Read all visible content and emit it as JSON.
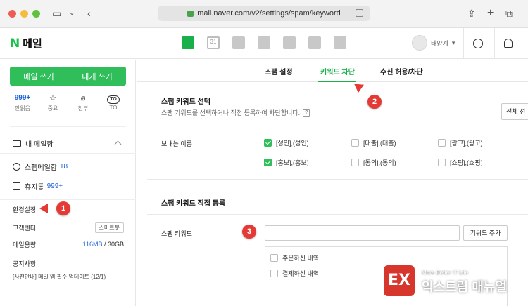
{
  "browser": {
    "url": "mail.naver.com/v2/settings/spam/keyword"
  },
  "header": {
    "logo_letter": "N",
    "logo_text": "메일",
    "calendar_day": "31",
    "profile_name": "태양계"
  },
  "sidebar": {
    "write_button": "메일 쓰기",
    "self_write_button": "내게 쓰기",
    "quick": [
      {
        "value": "999+",
        "label": "안읽음"
      },
      {
        "icon": "star-icon",
        "label": "중요"
      },
      {
        "icon": "paperclip-icon",
        "label": "첨부"
      },
      {
        "badge": "TO",
        "label": "TO"
      }
    ],
    "my_mailbox": "내 메일함",
    "spam_box": "스팸메일함",
    "spam_count": "18",
    "trash": "휴지통",
    "trash_count": "999+",
    "settings": "환경설정",
    "support": "고객센터",
    "smart_bot": "스마트봇",
    "storage_label": "메일용량",
    "storage_used": "116MB",
    "storage_total": "/ 30GB",
    "notice_label": "공지사항",
    "notice_text": "[사전안내] 메일 앱 필수 업데이트 (12/1)"
  },
  "main": {
    "tabs": [
      {
        "label": "스팸 설정"
      },
      {
        "label": "키워드 차단"
      },
      {
        "label": "수신 허용/차단"
      }
    ],
    "section1_title": "스팸 키워드 선택",
    "section1_desc": "스팸 키워드를 선택하거나 직접 등록하여 차단합니다.",
    "help": "?",
    "select_all": "전체 선",
    "sender_label": "보내는 이름",
    "checkboxes": [
      {
        "label": "[성인],(성인)",
        "checked": true
      },
      {
        "label": "[대출],(대출)",
        "checked": false
      },
      {
        "label": "[광고],(광고)",
        "checked": false
      },
      {
        "label": "[홍보],(홍보)",
        "checked": true
      },
      {
        "label": "[동의],(동의)",
        "checked": false
      },
      {
        "label": "[쇼핑],(쇼핑)",
        "checked": false
      }
    ],
    "section2_title": "스팸 키워드 직접 등록",
    "keyword_label": "스팸 키워드",
    "keyword_value": "",
    "add_button": "키워드 추가",
    "keyword_list": [
      {
        "label": "주문하신 내역"
      },
      {
        "label": "결제하신 내역"
      }
    ]
  },
  "annotations": {
    "marker1": "1",
    "marker2": "2",
    "marker3": "3",
    "color": "#e53935"
  },
  "watermark": {
    "symbol": "EX",
    "sub": "More Better IT Life",
    "main": "익스트림 매뉴얼"
  }
}
